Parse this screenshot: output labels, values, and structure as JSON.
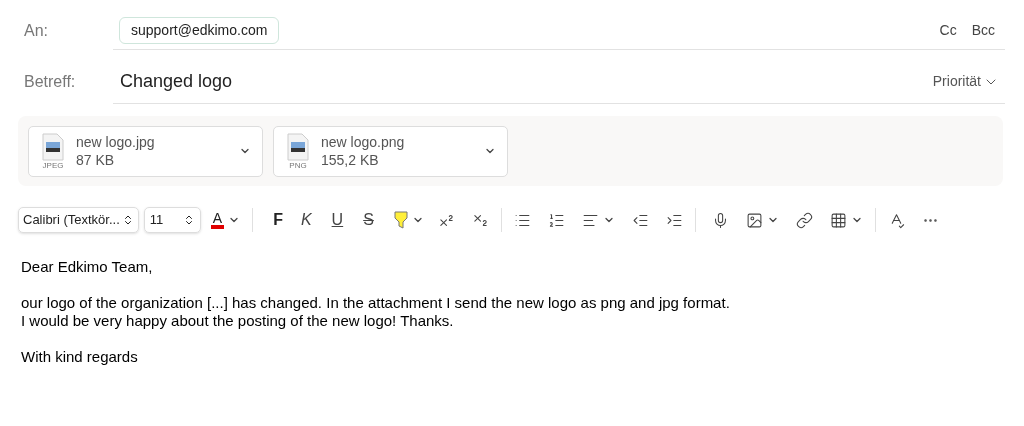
{
  "to": {
    "label": "An:",
    "recipients": [
      "support@edkimo.com"
    ],
    "cc": "Cc",
    "bcc": "Bcc"
  },
  "subject": {
    "label": "Betreff:",
    "value": "Changed logo",
    "priority": "Priorität"
  },
  "attachments": [
    {
      "name": "new logo.jpg",
      "size": "87 KB",
      "type": "JPEG"
    },
    {
      "name": "new logo.png",
      "size": "155,2 KB",
      "type": "PNG"
    }
  ],
  "toolbar": {
    "font": "Calibri (Textkör...",
    "size": "11",
    "color_letter": "A",
    "bold": "F",
    "italic": "K",
    "underline": "U",
    "strike": "S"
  },
  "body": [
    "Dear Edkimo Team,",
    "our logo of the organization [...] has changed. In the attachment I send the new logo as png and jpg format.\nI would be very happy about the posting of the new logo! Thanks.",
    "With kind regards"
  ]
}
